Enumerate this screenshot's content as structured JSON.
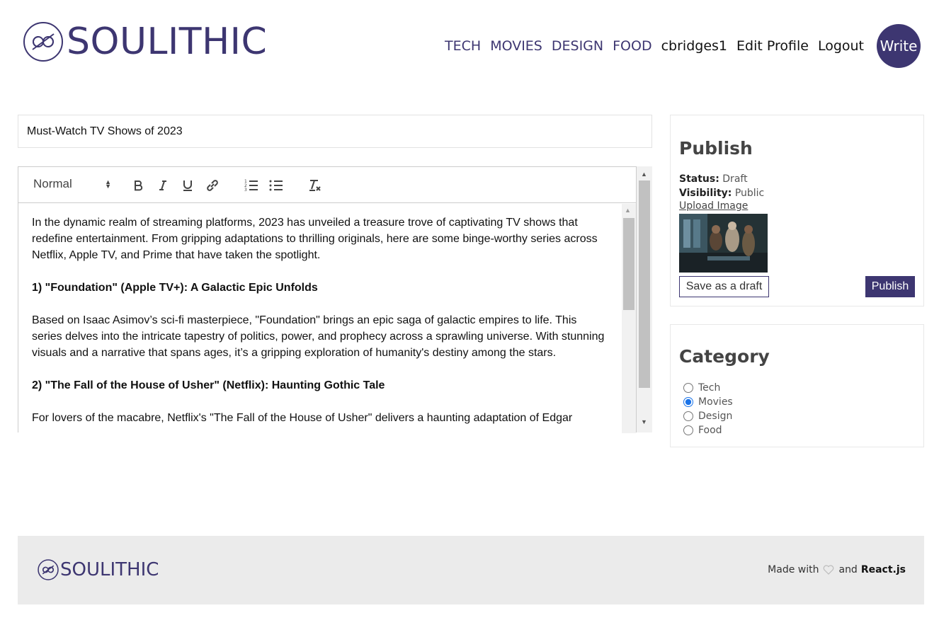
{
  "brand": {
    "name": "SOULITHIC",
    "accent": "#3d3671"
  },
  "nav": {
    "categories": [
      "TECH",
      "MOVIES",
      "DESIGN",
      "FOOD"
    ],
    "username": "cbridges1",
    "edit_profile": "Edit Profile",
    "logout": "Logout",
    "write": "Write"
  },
  "post": {
    "title": "Must-Watch TV Shows of 2023"
  },
  "editor": {
    "format_select": "Normal",
    "toolbar_icons": [
      "bold-icon",
      "italic-icon",
      "underline-icon",
      "link-icon",
      "ordered-list-icon",
      "bullet-list-icon",
      "clear-format-icon"
    ],
    "paragraphs": [
      "In the dynamic realm of streaming platforms, 2023 has unveiled a treasure trove of captivating TV shows that redefine entertainment. From gripping adaptations to thrilling originals, here are some binge-worthy series across Netflix, Apple TV, and Prime that have taken the spotlight.",
      "1) \"Foundation\" (Apple TV+): A Galactic Epic Unfolds",
      "Based on Isaac Asimov’s sci-fi masterpiece, \"Foundation\" brings an epic saga of galactic empires to life. This series delves into the intricate tapestry of politics, power, and prophecy across a sprawling universe. With stunning visuals and a narrative that spans ages, it’s a gripping exploration of humanity's destiny among the stars.",
      "2) \"The Fall of the House of Usher\" (Netflix): Haunting Gothic Tale",
      "For lovers of the macabre, Netflix's \"The Fall of the House of Usher\" delivers a haunting adaptation of Edgar"
    ]
  },
  "publish_panel": {
    "heading": "Publish",
    "status_label": "Status:",
    "status_value": "Draft",
    "visibility_label": "Visibility:",
    "visibility_value": "Public",
    "upload_link": "Upload Image",
    "save_draft": "Save as a draft",
    "publish": "Publish"
  },
  "category_panel": {
    "heading": "Category",
    "options": [
      "Tech",
      "Movies",
      "Design",
      "Food"
    ],
    "selected": "Movies"
  },
  "footer": {
    "brand": "SOULITHIC",
    "made_with": "Made with",
    "and": "and",
    "tech": "React.js"
  }
}
